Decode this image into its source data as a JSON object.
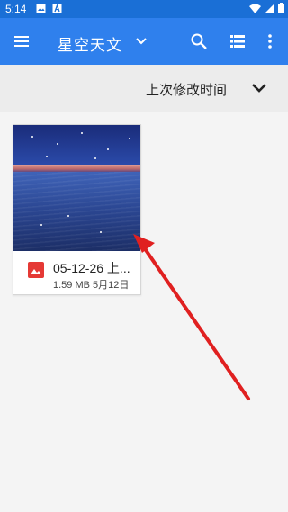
{
  "status_bar": {
    "time": "5:14",
    "icons": [
      "image-icon",
      "a-icon",
      "wifi-icon",
      "signal-icon",
      "battery-icon"
    ]
  },
  "app_bar": {
    "title": "星空天文",
    "icons": [
      "menu-icon",
      "chevron-down-icon",
      "search-icon",
      "list-view-icon",
      "more-vert-icon"
    ],
    "color": "#2f80ed"
  },
  "sort_bar": {
    "label": "上次修改时间"
  },
  "files": [
    {
      "name": "05-12-26 上...",
      "size": "1.59 MB",
      "date": "5月12日",
      "icon": "image-file-icon"
    }
  ],
  "annotation": {
    "type": "arrow",
    "color": "#e02020"
  }
}
